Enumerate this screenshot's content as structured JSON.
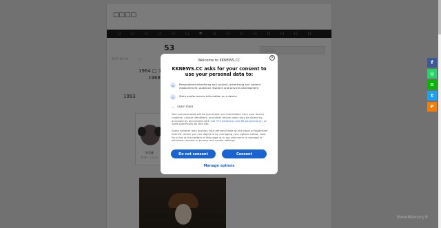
{
  "site": {
    "title": "□□□□",
    "nav_items": [
      "□",
      "□",
      "□",
      "□",
      "□",
      "□",
      "⌘",
      "□",
      "□",
      "□",
      "□",
      "□",
      "□",
      "□",
      "□"
    ],
    "headline": "53",
    "sidebar_box": "□□□□□",
    "date": "2017-10-10",
    "date_suffix": "□",
    "text_line1": "1964  □  13",
    "text_line2": "1988",
    "text_line3": "1993",
    "figure_caption_1": "牡羊座",
    "figure_caption_2": "Aries · □□□"
  },
  "share_bar": {
    "facebook": "f",
    "whatsapp": "◎",
    "line": "≡",
    "twitter": "t",
    "blogger": "P"
  },
  "watermark": "ВикиMemory®",
  "consent": {
    "close": "×",
    "welcome": "Welcome to KKNEWS.CC",
    "heading": "KKNEWS.CC asks for your consent to use your personal data to:",
    "purposes": [
      {
        "icon": "person-icon",
        "text": "Personalised advertising and content, advertising and content measurement, audience research and services development"
      },
      {
        "icon": "device-icon",
        "text": "Store and/or access information on a device"
      }
    ],
    "learn_more": "Learn more",
    "para1_a": "Your personal data will be processed and information from your device (cookies, unique identifiers, and other device data) may be stored by, accessed by and shared with ",
    "para1_link": "141 TCF vendor(s) and 69 ad partner(s)",
    "para1_b": ", or used specifically by this site.",
    "para2": "Some vendors may process your personal data on the basis of legitimate interest, which you can object to by managing your options below. Look for a link at the bottom of this page or in our site menu to manage or withdraw consent in privacy and cookie settings.",
    "do_not_consent": "Do not consent",
    "consent": "Consent",
    "manage": "Manage options"
  }
}
